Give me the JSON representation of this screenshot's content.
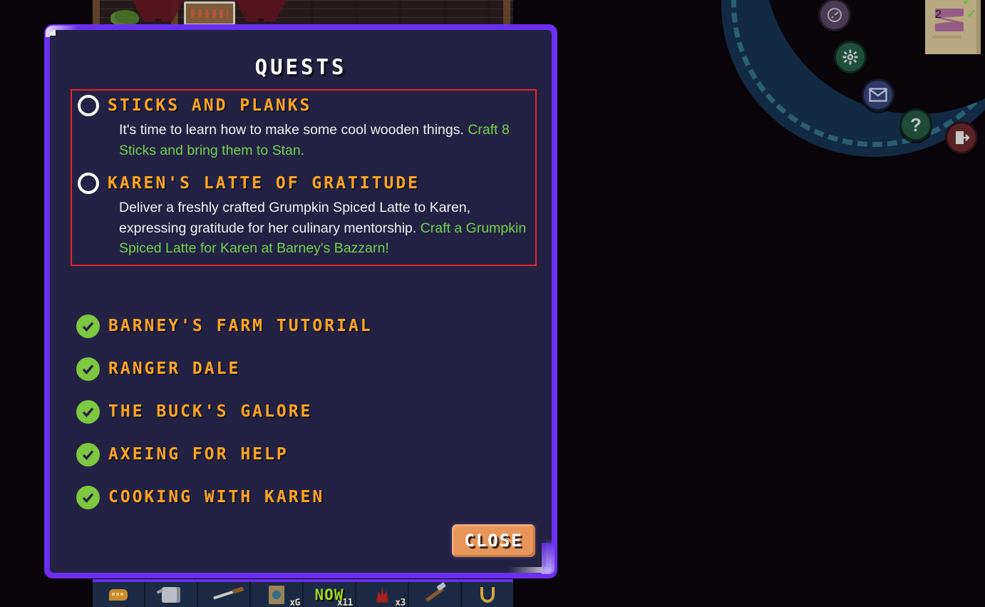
{
  "dialog": {
    "title": "QUESTS",
    "close_label": "CLOSE",
    "panel_bg": "#232244",
    "border_color": "#6b2fee",
    "active_box_border": "#e8252a",
    "title_color": "#ffffff",
    "quest_title_color": "#ffa51f",
    "objective_color": "#72d34a",
    "checkmark_bg": "#7ec740"
  },
  "active_quests": [
    {
      "status_icon": "radio-empty-icon",
      "title": "STICKS AND PLANKS",
      "description": "It's time to learn how to make some cool wooden things. ",
      "objective": "Craft 8 Sticks and bring them to Stan."
    },
    {
      "status_icon": "radio-empty-icon",
      "title": "KAREN'S LATTE OF GRATITUDE",
      "description": "Deliver a freshly crafted Grumpkin Spiced Latte to Karen, expressing gratitude for her culinary mentorship. ",
      "objective": "Craft a Grumpkin Spiced Latte for Karen at Barney's Bazzarn!"
    }
  ],
  "completed_quests": [
    {
      "status_icon": "check-circle-icon",
      "title": "BARNEY'S FARM TUTORIAL"
    },
    {
      "status_icon": "check-circle-icon",
      "title": "RANGER DALE"
    },
    {
      "status_icon": "check-circle-icon",
      "title": "THE BUCK'S GALORE"
    },
    {
      "status_icon": "check-circle-icon",
      "title": "AXEING FOR HELP"
    },
    {
      "status_icon": "check-circle-icon",
      "title": "COOKING WITH KAREN"
    }
  ],
  "side_menu": [
    {
      "icon": "speedometer-icon",
      "glyph": "◔",
      "name": "performance-button"
    },
    {
      "icon": "gear-icon",
      "glyph": "✾",
      "name": "settings-button"
    },
    {
      "icon": "mail-icon",
      "glyph": "✉",
      "name": "mail-button"
    },
    {
      "icon": "question-mark-icon",
      "glyph": "?",
      "name": "help-button"
    },
    {
      "icon": "exit-door-icon",
      "glyph": "⏻",
      "name": "logout-button"
    }
  ],
  "hotbar": [
    {
      "icon": "speech-bubble-icon",
      "qty": ""
    },
    {
      "icon": "watering-can-icon",
      "qty": ""
    },
    {
      "icon": "fishing-rod-icon",
      "qty": ""
    },
    {
      "icon": "book-icon",
      "qty": "xG"
    },
    {
      "icon": "now-label",
      "qty": "x11",
      "label": "NOW"
    },
    {
      "icon": "coral-icon",
      "qty": "x3"
    },
    {
      "icon": "pickaxe-icon",
      "qty": ""
    },
    {
      "icon": "hook-icon",
      "qty": ""
    }
  ],
  "background": {
    "parchment_number": "2",
    "parchment_checks": [
      "✓",
      "✓"
    ]
  }
}
